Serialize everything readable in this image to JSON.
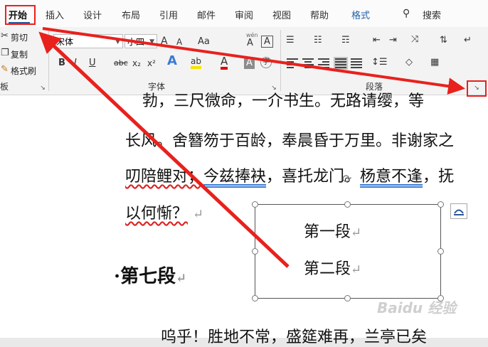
{
  "tabs": [
    "开始",
    "插入",
    "设计",
    "布局",
    "引用",
    "邮件",
    "审阅",
    "视图",
    "帮助",
    "格式"
  ],
  "search": {
    "label": "搜索"
  },
  "clipboard": {
    "cut": "剪切",
    "copy": "复制",
    "painter": "格式刷",
    "group_label": "板"
  },
  "font": {
    "name": "宋体",
    "size": "小四",
    "grow": "A",
    "shrink": "A",
    "case": "Aa",
    "phonetic_top": "wén",
    "phonetic": "A",
    "border_char": "A",
    "bold": "B",
    "italic": "I",
    "underline": "U",
    "strike": "abc",
    "sub": "x₂",
    "sup": "x²",
    "effect": "A",
    "highlight": "ab",
    "color": "A",
    "shade": "A",
    "enclose": "字",
    "group_label": "字体"
  },
  "paragraph": {
    "group_label": "段落"
  },
  "document": {
    "line1": "勃，三尺微命，一介书生。无路请缨，等",
    "line2": "长风。舍簪笏于百龄，奉晨昏于万里。非谢家之",
    "line3_a": "叨陪鲤对；",
    "line3_b": "今兹捧袂",
    "line3_c": "，喜托龙门。",
    "line3_d": "杨意不逢",
    "line3_e": "，抚",
    "line4": "以何惭？",
    "heading": "第七段",
    "shape_line1": "第一段",
    "shape_line2": "第二段",
    "last_line": "呜乎！胜地不常，盛筵难再，兰亭已矣",
    "para_mark": "↵"
  },
  "watermark": "Baidu 经验",
  "colors": {
    "annotation": "#e8211d",
    "highlight": "#f5e400",
    "font_color": "#e00000",
    "accent": "#2b579a"
  }
}
